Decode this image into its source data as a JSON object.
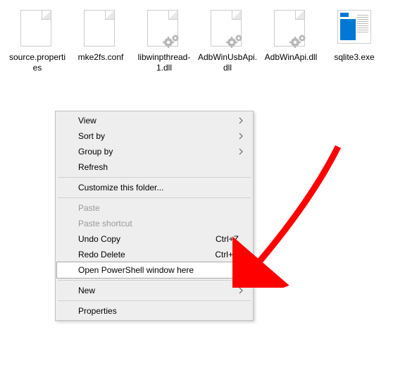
{
  "files": [
    {
      "name": "source.properties",
      "icon": "blank"
    },
    {
      "name": "mke2fs.conf",
      "icon": "blank"
    },
    {
      "name": "libwinpthread-1.dll",
      "icon": "gears"
    },
    {
      "name": "AdbWinUsbApi.dll",
      "icon": "gears"
    },
    {
      "name": "AdbWinApi.dll",
      "icon": "gears"
    },
    {
      "name": "sqlite3.exe",
      "icon": "exe"
    }
  ],
  "menu": {
    "view": "View",
    "sort_by": "Sort by",
    "group_by": "Group by",
    "refresh": "Refresh",
    "customize": "Customize this folder...",
    "paste": "Paste",
    "paste_shortcut": "Paste shortcut",
    "undo_copy": "Undo Copy",
    "undo_shortcut": "Ctrl+Z",
    "redo_delete": "Redo Delete",
    "redo_shortcut": "Ctrl+Y",
    "open_powershell": "Open PowerShell window here",
    "new": "New",
    "properties": "Properties"
  }
}
